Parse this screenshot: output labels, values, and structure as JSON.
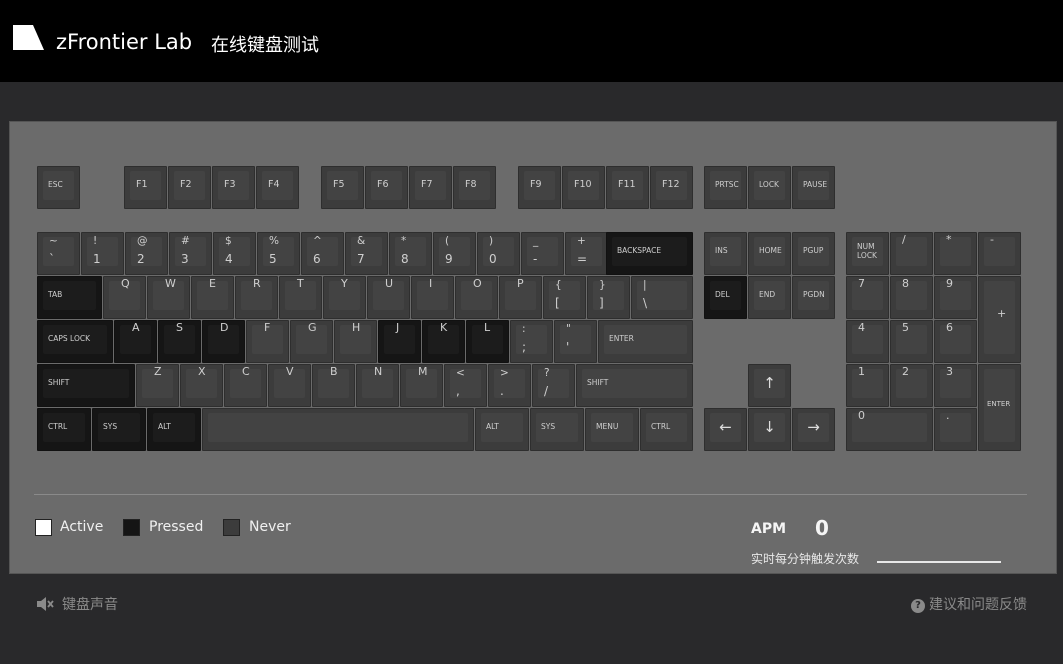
{
  "header": {
    "brand": "zFrontier Lab",
    "subtitle": "在线键盘测试"
  },
  "keys": {
    "esc": "ESC",
    "f1": "F1",
    "f2": "F2",
    "f3": "F3",
    "f4": "F4",
    "f5": "F5",
    "f6": "F6",
    "f7": "F7",
    "f8": "F8",
    "f9": "F9",
    "f10": "F10",
    "f11": "F11",
    "f12": "F12",
    "prtsc": "PRTSC",
    "lock": "LOCK",
    "pause": "PAUSE",
    "backtick": [
      "~",
      "`"
    ],
    "n1": [
      "!",
      "1"
    ],
    "n2": [
      "@",
      "2"
    ],
    "n3": [
      "#",
      "3"
    ],
    "n4": [
      "$",
      "4"
    ],
    "n5": [
      "%",
      "5"
    ],
    "n6": [
      "^",
      "6"
    ],
    "n7": [
      "&",
      "7"
    ],
    "n8": [
      "*",
      "8"
    ],
    "n9": [
      "(",
      "9"
    ],
    "n0": [
      ")",
      "0"
    ],
    "minus": [
      "_",
      "-"
    ],
    "equal": [
      "+",
      "="
    ],
    "backspace": "BACKSPACE",
    "ins": "INS",
    "home": "HOME",
    "pgup": "PGUP",
    "numlock": "NUM\nLOCK",
    "np_div": "/",
    "np_mul": "*",
    "np_sub": "-",
    "tab": "TAB",
    "q": "Q",
    "w": "W",
    "e": "E",
    "r": "R",
    "t": "T",
    "y": "Y",
    "u": "U",
    "i": "I",
    "o": "O",
    "p": "P",
    "lbracket": [
      "{",
      "["
    ],
    "rbracket": [
      "}",
      "]"
    ],
    "backslash": [
      "|",
      "\\"
    ],
    "del": "DEL",
    "end": "END",
    "pgdn": "PGDN",
    "np7": "7",
    "np8": "8",
    "np9": "9",
    "np_add": "+",
    "caps": "CAPS LOCK",
    "a": "A",
    "s": "S",
    "d": "D",
    "f": "F",
    "g": "G",
    "h": "H",
    "j": "J",
    "k": "K",
    "l": "L",
    "semicolon": [
      ":",
      ";"
    ],
    "quote": [
      "\"",
      "'"
    ],
    "enter": "ENTER",
    "np4": "4",
    "np5": "5",
    "np6": "6",
    "lshift": "SHIFT",
    "z": "Z",
    "x": "X",
    "c": "C",
    "v": "V",
    "b": "B",
    "n": "N",
    "m": "M",
    "comma": [
      "<",
      ","
    ],
    "period": [
      ">",
      "."
    ],
    "slash": [
      "?",
      "/"
    ],
    "rshift": "SHIFT",
    "up": "↑",
    "np1": "1",
    "np2": "2",
    "np3": "3",
    "np_enter": "ENTER",
    "lctrl": "CTRL",
    "lsys": "SYS",
    "lalt": "ALT",
    "ralt": "ALT",
    "rsys": "SYS",
    "menu": "MENU",
    "rctrl": "CTRL",
    "left": "←",
    "down": "↓",
    "right": "→",
    "np0": "0",
    "np_dot": "."
  },
  "pressed_keys": [
    "backspace",
    "tab",
    "caps",
    "a",
    "s",
    "d",
    "j",
    "k",
    "l",
    "lshift",
    "lctrl",
    "lsys",
    "lalt",
    "del"
  ],
  "legend": {
    "active": "Active",
    "pressed": "Pressed",
    "never": "Never"
  },
  "legend_colors": {
    "active": "#ffffff",
    "pressed": "#151515",
    "never": "#3c3c3c"
  },
  "apm": {
    "label": "APM",
    "value": "0",
    "description": "实时每分钟触发次数"
  },
  "footer": {
    "sound": "键盘声音",
    "feedback": "建议和问题反馈",
    "sound_icon": "speaker-muted-icon",
    "feedback_icon": "question-circle-icon"
  }
}
